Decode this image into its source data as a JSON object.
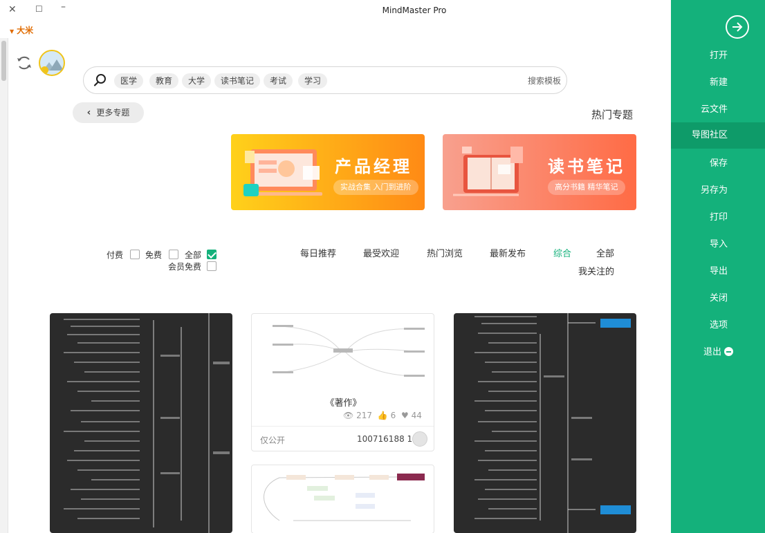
{
  "window": {
    "title": "MindMaster Pro",
    "font_size_label": "大米"
  },
  "sidebar": {
    "items": [
      {
        "label": "打开"
      },
      {
        "label": "新建"
      },
      {
        "label": "云文件"
      },
      {
        "label": "导图社区",
        "active": true
      },
      {
        "label": "保存"
      },
      {
        "label": "另存为"
      },
      {
        "label": "打印"
      },
      {
        "label": "导入"
      },
      {
        "label": "导出"
      },
      {
        "label": "关闭"
      },
      {
        "label": "选项"
      },
      {
        "label": "退出"
      }
    ],
    "accent_color": "#14b17b"
  },
  "search": {
    "placeholder": "搜索模板",
    "tags": [
      "学习",
      "考试",
      "读书笔记",
      "大学",
      "教育",
      "医学"
    ]
  },
  "topics": {
    "section_title": "热门专题",
    "more_button": "更多专题",
    "banners": [
      {
        "title": "读书笔记",
        "subtitle": "高分书籍 精华笔记"
      },
      {
        "title": "产品经理",
        "subtitle": "实战合集 入门到进阶"
      }
    ]
  },
  "sort_tabs": [
    "全部",
    "综合",
    "最新发布",
    "热门浏览",
    "最受欢迎",
    "每日推荐",
    "我关注的"
  ],
  "active_sort": "综合",
  "filters": [
    {
      "label": "全部",
      "checked": true
    },
    {
      "label": "免费",
      "checked": false
    },
    {
      "label": "付费",
      "checked": false
    },
    {
      "label": "会员免费",
      "checked": false
    }
  ],
  "cards": [
    {
      "title": "《著作》",
      "views": "217",
      "likes": "6",
      "favorites": "44",
      "author_id": "100716188 1",
      "category": "仅公开"
    }
  ]
}
